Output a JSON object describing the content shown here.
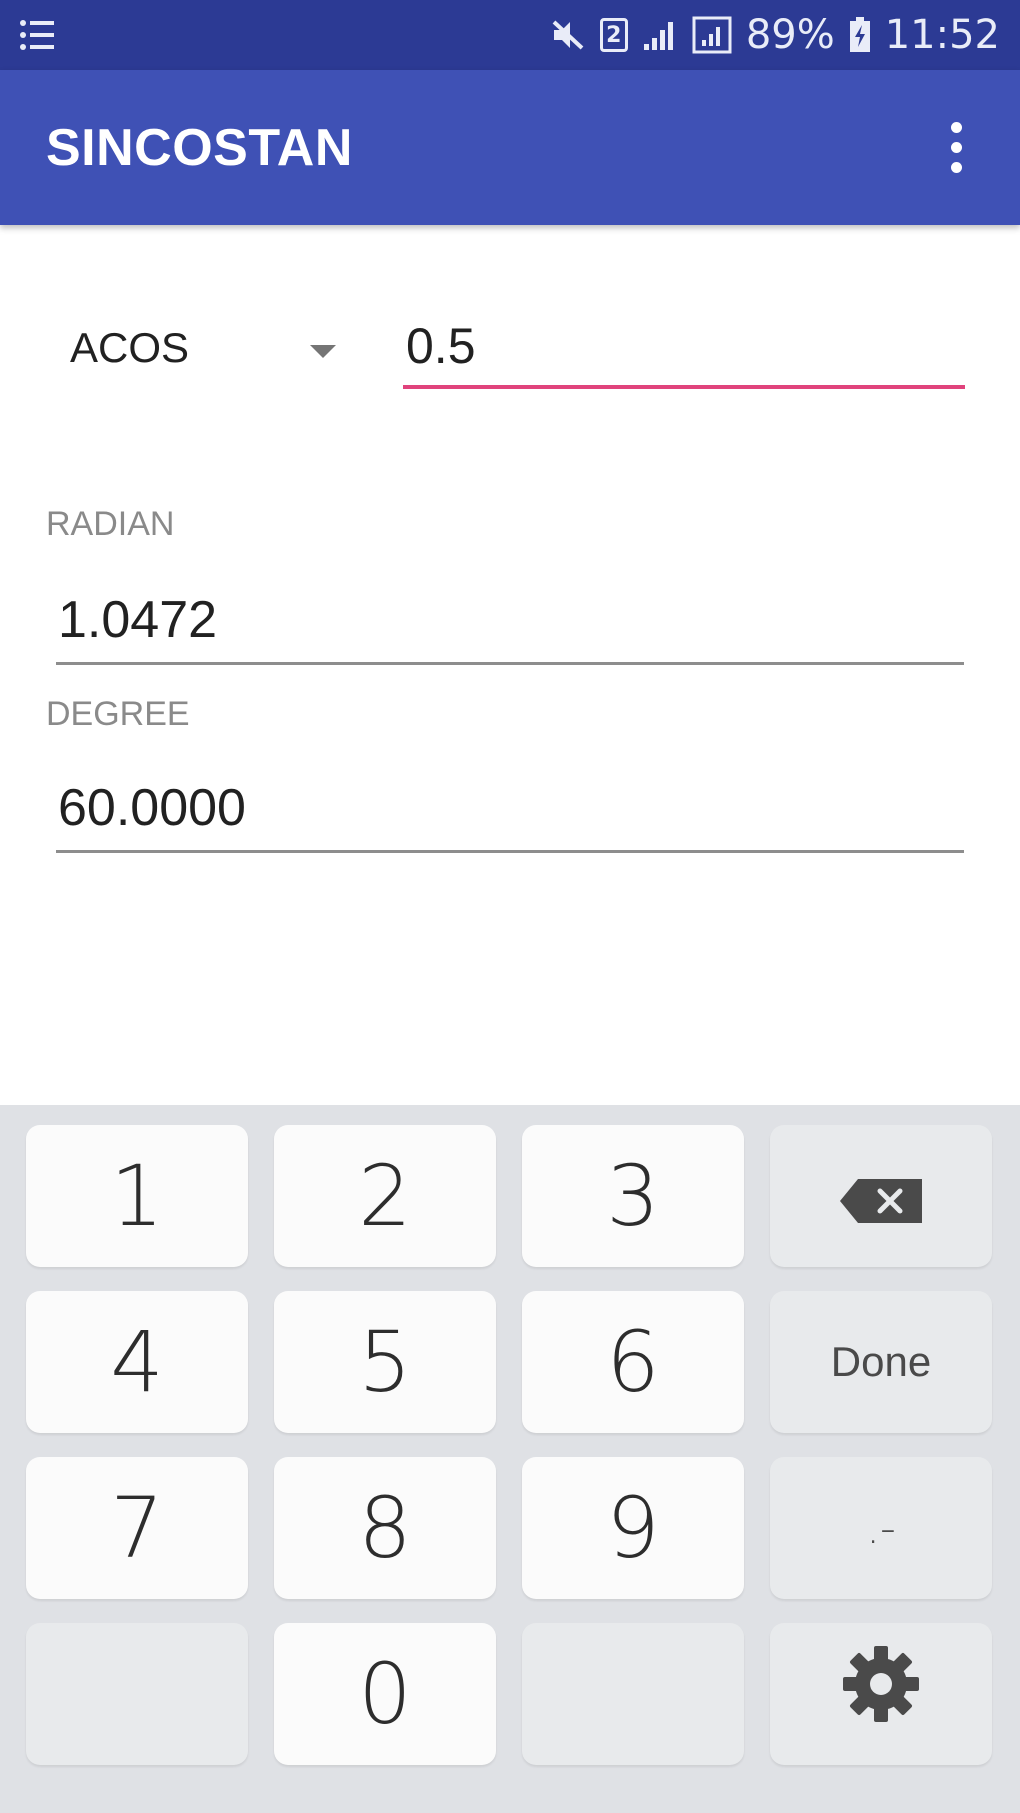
{
  "status_bar": {
    "battery": "89%",
    "time": "11:52",
    "sim_badge": "2",
    "icons": [
      "notification-list-icon",
      "mute-icon",
      "sim-card-icon",
      "signal-icon",
      "signal-box-icon",
      "battery-charging-icon"
    ]
  },
  "app_bar": {
    "title": "SINCOSTAN",
    "menu_icon": "overflow-menu-icon"
  },
  "main": {
    "function_select": {
      "selected": "ACOS"
    },
    "input": {
      "value": "0.5"
    },
    "radian": {
      "label": "RADIAN",
      "value": "1.0472"
    },
    "degree": {
      "label": "DEGREE",
      "value": "60.0000"
    }
  },
  "keyboard": {
    "keys": {
      "k1": "1",
      "k2": "2",
      "k3": "3",
      "k4": "4",
      "k5": "5",
      "k6": "6",
      "k7": "7",
      "k8": "8",
      "k9": "9",
      "k0": "0",
      "done": "Done",
      "dot_minus": ".-"
    },
    "icons": [
      "backspace-icon",
      "settings-gear-icon"
    ]
  },
  "colors": {
    "status_bar": "#2c3a94",
    "app_bar": "#3f51b5",
    "accent_underline": "#e0437c",
    "keyboard_bg": "#dfe1e5"
  }
}
